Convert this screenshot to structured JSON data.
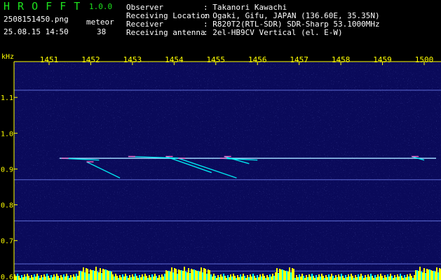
{
  "app": {
    "name": "H R O F F T",
    "version": "1.0.0"
  },
  "file": {
    "name": "2508151450.png",
    "timestamp": "25.08.15 14:50"
  },
  "meteor": {
    "label": "meteor",
    "count": "38"
  },
  "info": [
    {
      "label": "Observer",
      "value": ": Takanori Kawachi"
    },
    {
      "label": "Receiving Location",
      "value": ": Ogaki, Gifu, JAPAN (136.60E, 35.35N)"
    },
    {
      "label": "Receiver",
      "value": ": R820T2(RTL-SDR) SDR-Sharp 53.1000MHz"
    },
    {
      "label": "Receiving antenna",
      "value": ": 2el-HB9CV Vertical (el. E-W)"
    }
  ],
  "colors": {
    "background": "#0a0a5a",
    "axis": "#ffff00",
    "label_green": "#1ee21e",
    "trace": "#00ffff"
  },
  "chart_data": {
    "type": "heatmap",
    "yunit": "kHz",
    "x_ticks": [
      "1451",
      "1452",
      "1453",
      "1454",
      "1455",
      "1456",
      "1457",
      "1458",
      "1459",
      "1500"
    ],
    "y_ticks": [
      "1.1",
      "1.0",
      "0.9",
      "0.8",
      "0.7",
      "0.6"
    ],
    "y_tick_values": [
      1.1,
      1.0,
      0.9,
      0.8,
      0.7,
      0.6
    ],
    "ylim": [
      0.59,
      1.2
    ],
    "x_minutes": [
      1,
      10
    ],
    "carrier_khz": 0.93,
    "hlines_khz": [
      1.12,
      0.87,
      0.755,
      0.635,
      0.615
    ],
    "meteor_echoes": [
      {
        "start": 1.3,
        "end": 2.2,
        "f_start": 0.93,
        "f_end": 0.925
      },
      {
        "start": 1.9,
        "end": 2.7,
        "f_start": 0.92,
        "f_end": 0.875
      },
      {
        "start": 2.9,
        "end": 4.2,
        "f_start": 0.935,
        "f_end": 0.93
      },
      {
        "start": 3.8,
        "end": 4.9,
        "f_start": 0.935,
        "f_end": 0.89
      },
      {
        "start": 4.1,
        "end": 5.5,
        "f_start": 0.93,
        "f_end": 0.875
      },
      {
        "start": 5.1,
        "end": 6.0,
        "f_start": 0.93,
        "f_end": 0.925
      },
      {
        "start": 5.2,
        "end": 5.8,
        "f_start": 0.935,
        "f_end": 0.915
      },
      {
        "start": 9.7,
        "end": 10.0,
        "f_start": 0.935,
        "f_end": 0.925
      }
    ]
  }
}
